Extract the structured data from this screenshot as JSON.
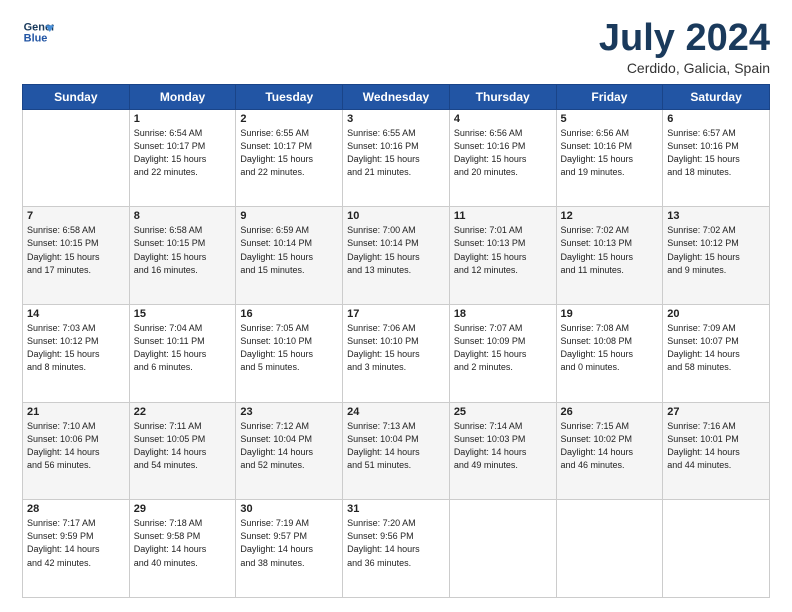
{
  "header": {
    "logo_line1": "General",
    "logo_line2": "Blue",
    "title": "July 2024",
    "subtitle": "Cerdido, Galicia, Spain"
  },
  "calendar": {
    "days_of_week": [
      "Sunday",
      "Monday",
      "Tuesday",
      "Wednesday",
      "Thursday",
      "Friday",
      "Saturday"
    ],
    "weeks": [
      [
        {
          "day": "",
          "info": ""
        },
        {
          "day": "1",
          "info": "Sunrise: 6:54 AM\nSunset: 10:17 PM\nDaylight: 15 hours\nand 22 minutes."
        },
        {
          "day": "2",
          "info": "Sunrise: 6:55 AM\nSunset: 10:17 PM\nDaylight: 15 hours\nand 22 minutes."
        },
        {
          "day": "3",
          "info": "Sunrise: 6:55 AM\nSunset: 10:16 PM\nDaylight: 15 hours\nand 21 minutes."
        },
        {
          "day": "4",
          "info": "Sunrise: 6:56 AM\nSunset: 10:16 PM\nDaylight: 15 hours\nand 20 minutes."
        },
        {
          "day": "5",
          "info": "Sunrise: 6:56 AM\nSunset: 10:16 PM\nDaylight: 15 hours\nand 19 minutes."
        },
        {
          "day": "6",
          "info": "Sunrise: 6:57 AM\nSunset: 10:16 PM\nDaylight: 15 hours\nand 18 minutes."
        }
      ],
      [
        {
          "day": "7",
          "info": "Sunrise: 6:58 AM\nSunset: 10:15 PM\nDaylight: 15 hours\nand 17 minutes."
        },
        {
          "day": "8",
          "info": "Sunrise: 6:58 AM\nSunset: 10:15 PM\nDaylight: 15 hours\nand 16 minutes."
        },
        {
          "day": "9",
          "info": "Sunrise: 6:59 AM\nSunset: 10:14 PM\nDaylight: 15 hours\nand 15 minutes."
        },
        {
          "day": "10",
          "info": "Sunrise: 7:00 AM\nSunset: 10:14 PM\nDaylight: 15 hours\nand 13 minutes."
        },
        {
          "day": "11",
          "info": "Sunrise: 7:01 AM\nSunset: 10:13 PM\nDaylight: 15 hours\nand 12 minutes."
        },
        {
          "day": "12",
          "info": "Sunrise: 7:02 AM\nSunset: 10:13 PM\nDaylight: 15 hours\nand 11 minutes."
        },
        {
          "day": "13",
          "info": "Sunrise: 7:02 AM\nSunset: 10:12 PM\nDaylight: 15 hours\nand 9 minutes."
        }
      ],
      [
        {
          "day": "14",
          "info": "Sunrise: 7:03 AM\nSunset: 10:12 PM\nDaylight: 15 hours\nand 8 minutes."
        },
        {
          "day": "15",
          "info": "Sunrise: 7:04 AM\nSunset: 10:11 PM\nDaylight: 15 hours\nand 6 minutes."
        },
        {
          "day": "16",
          "info": "Sunrise: 7:05 AM\nSunset: 10:10 PM\nDaylight: 15 hours\nand 5 minutes."
        },
        {
          "day": "17",
          "info": "Sunrise: 7:06 AM\nSunset: 10:10 PM\nDaylight: 15 hours\nand 3 minutes."
        },
        {
          "day": "18",
          "info": "Sunrise: 7:07 AM\nSunset: 10:09 PM\nDaylight: 15 hours\nand 2 minutes."
        },
        {
          "day": "19",
          "info": "Sunrise: 7:08 AM\nSunset: 10:08 PM\nDaylight: 15 hours\nand 0 minutes."
        },
        {
          "day": "20",
          "info": "Sunrise: 7:09 AM\nSunset: 10:07 PM\nDaylight: 14 hours\nand 58 minutes."
        }
      ],
      [
        {
          "day": "21",
          "info": "Sunrise: 7:10 AM\nSunset: 10:06 PM\nDaylight: 14 hours\nand 56 minutes."
        },
        {
          "day": "22",
          "info": "Sunrise: 7:11 AM\nSunset: 10:05 PM\nDaylight: 14 hours\nand 54 minutes."
        },
        {
          "day": "23",
          "info": "Sunrise: 7:12 AM\nSunset: 10:04 PM\nDaylight: 14 hours\nand 52 minutes."
        },
        {
          "day": "24",
          "info": "Sunrise: 7:13 AM\nSunset: 10:04 PM\nDaylight: 14 hours\nand 51 minutes."
        },
        {
          "day": "25",
          "info": "Sunrise: 7:14 AM\nSunset: 10:03 PM\nDaylight: 14 hours\nand 49 minutes."
        },
        {
          "day": "26",
          "info": "Sunrise: 7:15 AM\nSunset: 10:02 PM\nDaylight: 14 hours\nand 46 minutes."
        },
        {
          "day": "27",
          "info": "Sunrise: 7:16 AM\nSunset: 10:01 PM\nDaylight: 14 hours\nand 44 minutes."
        }
      ],
      [
        {
          "day": "28",
          "info": "Sunrise: 7:17 AM\nSunset: 9:59 PM\nDaylight: 14 hours\nand 42 minutes."
        },
        {
          "day": "29",
          "info": "Sunrise: 7:18 AM\nSunset: 9:58 PM\nDaylight: 14 hours\nand 40 minutes."
        },
        {
          "day": "30",
          "info": "Sunrise: 7:19 AM\nSunset: 9:57 PM\nDaylight: 14 hours\nand 38 minutes."
        },
        {
          "day": "31",
          "info": "Sunrise: 7:20 AM\nSunset: 9:56 PM\nDaylight: 14 hours\nand 36 minutes."
        },
        {
          "day": "",
          "info": ""
        },
        {
          "day": "",
          "info": ""
        },
        {
          "day": "",
          "info": ""
        }
      ]
    ]
  }
}
